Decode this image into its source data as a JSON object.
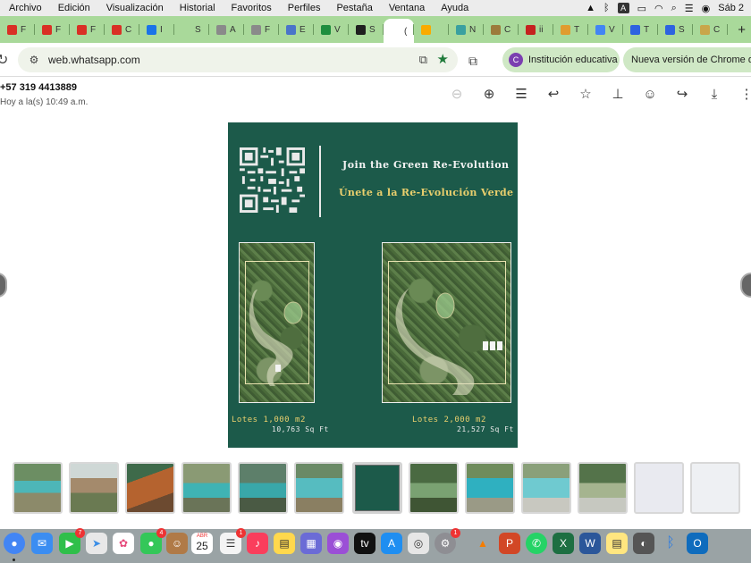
{
  "menubar": {
    "items": [
      "Archivo",
      "Edición",
      "Visualización",
      "Historial",
      "Favoritos",
      "Perfiles",
      "Pestaña",
      "Ventana",
      "Ayuda"
    ],
    "keyboard_indicator": "A",
    "clock": "Sáb 2"
  },
  "tabs": [
    {
      "favicon": "gmail-icon",
      "label": "F",
      "color": "#d93025"
    },
    {
      "favicon": "gmail-icon",
      "label": "F",
      "color": "#d93025"
    },
    {
      "favicon": "gmail-icon",
      "label": "F",
      "color": "#d93025"
    },
    {
      "favicon": "gmail-icon",
      "label": "C",
      "color": "#d93025"
    },
    {
      "favicon": "globe-icon",
      "label": "I",
      "color": "#1a73e8"
    },
    {
      "favicon": "blank-icon",
      "label": "S",
      "color": "#a9d99a"
    },
    {
      "favicon": "gear-icon",
      "label": "A",
      "color": "#8a8a8a"
    },
    {
      "favicon": "gear-icon",
      "label": "F",
      "color": "#8a8a8a"
    },
    {
      "favicon": "site-icon",
      "label": "E",
      "color": "#4a74c9"
    },
    {
      "favicon": "sheets-icon",
      "label": "V",
      "color": "#1e8e3e"
    },
    {
      "favicon": "scribd-icon",
      "label": "S",
      "color": "#1f1f1f"
    },
    {
      "favicon": "blank-icon",
      "label": "(",
      "color": "#ffffff",
      "active": true
    },
    {
      "favicon": "drive-icon",
      "label": "",
      "color": "#f9ab00"
    },
    {
      "favicon": "site-icon",
      "label": "N",
      "color": "#3aa0a0"
    },
    {
      "favicon": "tk-icon",
      "label": "C",
      "color": "#9c7b3b"
    },
    {
      "favicon": "site-icon",
      "label": "ii",
      "color": "#c5221f"
    },
    {
      "favicon": "site-icon",
      "label": "T",
      "color": "#e09c2f"
    },
    {
      "favicon": "google-icon",
      "label": "V",
      "color": "#4285f4"
    },
    {
      "favicon": "site-icon",
      "label": "T",
      "color": "#2d63e0"
    },
    {
      "favicon": "site-icon",
      "label": "S",
      "color": "#2d63e0"
    },
    {
      "favicon": "site-icon",
      "label": "C",
      "color": "#c9a64a"
    }
  ],
  "toolbar": {
    "url": "web.whatsapp.com",
    "profile_label": "Institución educativa",
    "profile_initial": "C",
    "update_label": "Nueva versión de Chrome dis"
  },
  "viewer": {
    "contact": "+57 319 4413889",
    "timestamp": "Hoy a la(s) 10:49 a.m."
  },
  "image": {
    "title_en": "Join the Green Re-Evolution",
    "title_es": "Únete a la Re-Evolución Verde",
    "lot1_label": "Lotes   1,000 m2",
    "lot1_sqft": "10,763 Sq Ft",
    "lot2_label": "Lotes   2,000 m2",
    "lot2_sqft": "21,527 Sq Ft"
  },
  "dock": {
    "calendar_month": "ABR",
    "calendar_day": "25",
    "facetime_badge": "7",
    "messages_badge": "4",
    "reminders_badge": "1",
    "settings_badge": "1"
  }
}
